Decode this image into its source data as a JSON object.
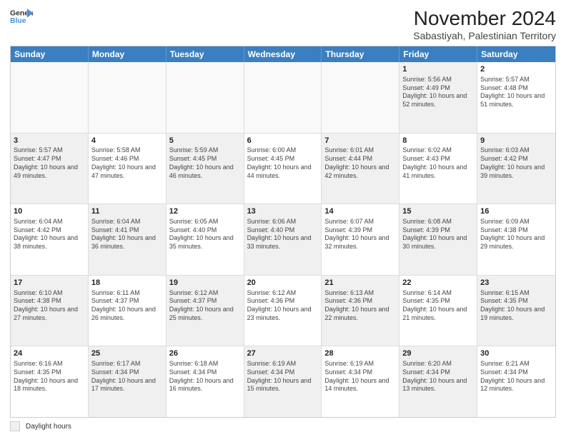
{
  "logo": {
    "line1": "General",
    "line2": "Blue"
  },
  "title": "November 2024",
  "location": "Sabastiyah, Palestinian Territory",
  "days_of_week": [
    "Sunday",
    "Monday",
    "Tuesday",
    "Wednesday",
    "Thursday",
    "Friday",
    "Saturday"
  ],
  "rows": [
    [
      {
        "day": "",
        "info": "",
        "shaded": false,
        "empty": true
      },
      {
        "day": "",
        "info": "",
        "shaded": false,
        "empty": true
      },
      {
        "day": "",
        "info": "",
        "shaded": false,
        "empty": true
      },
      {
        "day": "",
        "info": "",
        "shaded": false,
        "empty": true
      },
      {
        "day": "",
        "info": "",
        "shaded": false,
        "empty": true
      },
      {
        "day": "1",
        "info": "Sunrise: 5:56 AM\nSunset: 4:49 PM\nDaylight: 10 hours and 52 minutes.",
        "shaded": true
      },
      {
        "day": "2",
        "info": "Sunrise: 5:57 AM\nSunset: 4:48 PM\nDaylight: 10 hours and 51 minutes.",
        "shaded": false
      }
    ],
    [
      {
        "day": "3",
        "info": "Sunrise: 5:57 AM\nSunset: 4:47 PM\nDaylight: 10 hours and 49 minutes.",
        "shaded": true
      },
      {
        "day": "4",
        "info": "Sunrise: 5:58 AM\nSunset: 4:46 PM\nDaylight: 10 hours and 47 minutes.",
        "shaded": false
      },
      {
        "day": "5",
        "info": "Sunrise: 5:59 AM\nSunset: 4:45 PM\nDaylight: 10 hours and 46 minutes.",
        "shaded": true
      },
      {
        "day": "6",
        "info": "Sunrise: 6:00 AM\nSunset: 4:45 PM\nDaylight: 10 hours and 44 minutes.",
        "shaded": false
      },
      {
        "day": "7",
        "info": "Sunrise: 6:01 AM\nSunset: 4:44 PM\nDaylight: 10 hours and 42 minutes.",
        "shaded": true
      },
      {
        "day": "8",
        "info": "Sunrise: 6:02 AM\nSunset: 4:43 PM\nDaylight: 10 hours and 41 minutes.",
        "shaded": false
      },
      {
        "day": "9",
        "info": "Sunrise: 6:03 AM\nSunset: 4:42 PM\nDaylight: 10 hours and 39 minutes.",
        "shaded": true
      }
    ],
    [
      {
        "day": "10",
        "info": "Sunrise: 6:04 AM\nSunset: 4:42 PM\nDaylight: 10 hours and 38 minutes.",
        "shaded": false
      },
      {
        "day": "11",
        "info": "Sunrise: 6:04 AM\nSunset: 4:41 PM\nDaylight: 10 hours and 36 minutes.",
        "shaded": true
      },
      {
        "day": "12",
        "info": "Sunrise: 6:05 AM\nSunset: 4:40 PM\nDaylight: 10 hours and 35 minutes.",
        "shaded": false
      },
      {
        "day": "13",
        "info": "Sunrise: 6:06 AM\nSunset: 4:40 PM\nDaylight: 10 hours and 33 minutes.",
        "shaded": true
      },
      {
        "day": "14",
        "info": "Sunrise: 6:07 AM\nSunset: 4:39 PM\nDaylight: 10 hours and 32 minutes.",
        "shaded": false
      },
      {
        "day": "15",
        "info": "Sunrise: 6:08 AM\nSunset: 4:39 PM\nDaylight: 10 hours and 30 minutes.",
        "shaded": true
      },
      {
        "day": "16",
        "info": "Sunrise: 6:09 AM\nSunset: 4:38 PM\nDaylight: 10 hours and 29 minutes.",
        "shaded": false
      }
    ],
    [
      {
        "day": "17",
        "info": "Sunrise: 6:10 AM\nSunset: 4:38 PM\nDaylight: 10 hours and 27 minutes.",
        "shaded": true
      },
      {
        "day": "18",
        "info": "Sunrise: 6:11 AM\nSunset: 4:37 PM\nDaylight: 10 hours and 26 minutes.",
        "shaded": false
      },
      {
        "day": "19",
        "info": "Sunrise: 6:12 AM\nSunset: 4:37 PM\nDaylight: 10 hours and 25 minutes.",
        "shaded": true
      },
      {
        "day": "20",
        "info": "Sunrise: 6:12 AM\nSunset: 4:36 PM\nDaylight: 10 hours and 23 minutes.",
        "shaded": false
      },
      {
        "day": "21",
        "info": "Sunrise: 6:13 AM\nSunset: 4:36 PM\nDaylight: 10 hours and 22 minutes.",
        "shaded": true
      },
      {
        "day": "22",
        "info": "Sunrise: 6:14 AM\nSunset: 4:35 PM\nDaylight: 10 hours and 21 minutes.",
        "shaded": false
      },
      {
        "day": "23",
        "info": "Sunrise: 6:15 AM\nSunset: 4:35 PM\nDaylight: 10 hours and 19 minutes.",
        "shaded": true
      }
    ],
    [
      {
        "day": "24",
        "info": "Sunrise: 6:16 AM\nSunset: 4:35 PM\nDaylight: 10 hours and 18 minutes.",
        "shaded": false
      },
      {
        "day": "25",
        "info": "Sunrise: 6:17 AM\nSunset: 4:34 PM\nDaylight: 10 hours and 17 minutes.",
        "shaded": true
      },
      {
        "day": "26",
        "info": "Sunrise: 6:18 AM\nSunset: 4:34 PM\nDaylight: 10 hours and 16 minutes.",
        "shaded": false
      },
      {
        "day": "27",
        "info": "Sunrise: 6:19 AM\nSunset: 4:34 PM\nDaylight: 10 hours and 15 minutes.",
        "shaded": true
      },
      {
        "day": "28",
        "info": "Sunrise: 6:19 AM\nSunset: 4:34 PM\nDaylight: 10 hours and 14 minutes.",
        "shaded": false
      },
      {
        "day": "29",
        "info": "Sunrise: 6:20 AM\nSunset: 4:34 PM\nDaylight: 10 hours and 13 minutes.",
        "shaded": true
      },
      {
        "day": "30",
        "info": "Sunrise: 6:21 AM\nSunset: 4:34 PM\nDaylight: 10 hours and 12 minutes.",
        "shaded": false
      }
    ]
  ],
  "legend": {
    "shaded_label": "Daylight hours"
  }
}
